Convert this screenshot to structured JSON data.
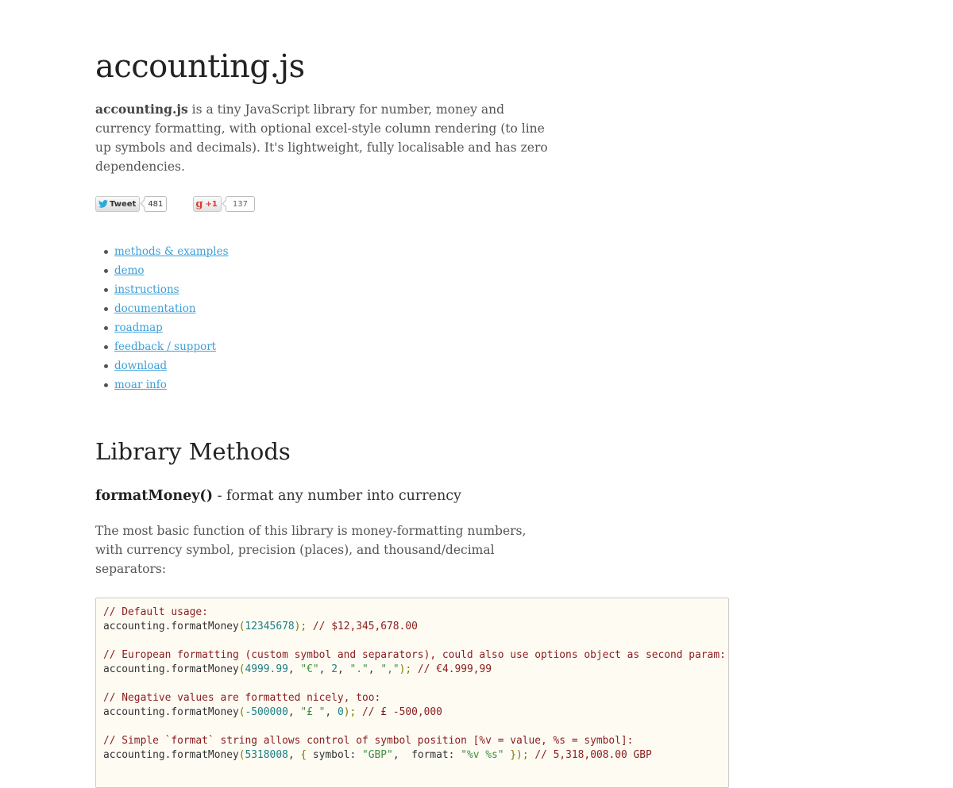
{
  "header": {
    "title": "accounting.js",
    "intro_bold": "accounting.js",
    "intro_rest": " is a tiny JavaScript library for number, money and currency formatting, with optional excel-style column rendering (to line up symbols and decimals). It's lightweight, fully localisable and has zero dependencies."
  },
  "social": {
    "tweet_label": "Tweet",
    "tweet_count": "481",
    "gplus_icon": "g",
    "gplus_label": "+1",
    "gplus_count": "137"
  },
  "nav": {
    "items": [
      {
        "label": "methods & examples"
      },
      {
        "label": "demo"
      },
      {
        "label": "instructions"
      },
      {
        "label": "documentation"
      },
      {
        "label": "roadmap"
      },
      {
        "label": "feedback / support"
      },
      {
        "label": "download"
      },
      {
        "label": "moar info"
      }
    ]
  },
  "section": {
    "title": "Library Methods",
    "method_name": "formatMoney()",
    "method_desc": " - format any number into currency",
    "description": "The most basic function of this library is money-formatting numbers, with currency symbol, precision (places), and thousand/decimal separators:"
  },
  "code": {
    "lines": [
      "// Default usage:",
      "accounting.formatMoney(12345678); // $12,345,678.00",
      "",
      "// European formatting (custom symbol and separators), could also use options object as second param:",
      "accounting.formatMoney(4999.99, \"€\", 2, \".\", \",\"); // €4.999,99",
      "",
      "// Negative values are formatted nicely, too:",
      "accounting.formatMoney(-500000, \"£ \", 0); // £ -500,000",
      "",
      "// Simple `format` string allows control of symbol position [%v = value, %s = symbol]:",
      "accounting.formatMoney(5318008, { symbol: \"GBP\",  format: \"%v %s\" }); // 5,318,008.00 GBP"
    ],
    "colors": {
      "comment": "#8b1c1c",
      "number": "#1a7f86",
      "string": "#3d8f3d",
      "punctuation": "#7a7a00",
      "background": "#fefbf3"
    }
  },
  "colors": {
    "link": "#3d9fd8",
    "heading": "#222222",
    "body_text": "#555555"
  }
}
